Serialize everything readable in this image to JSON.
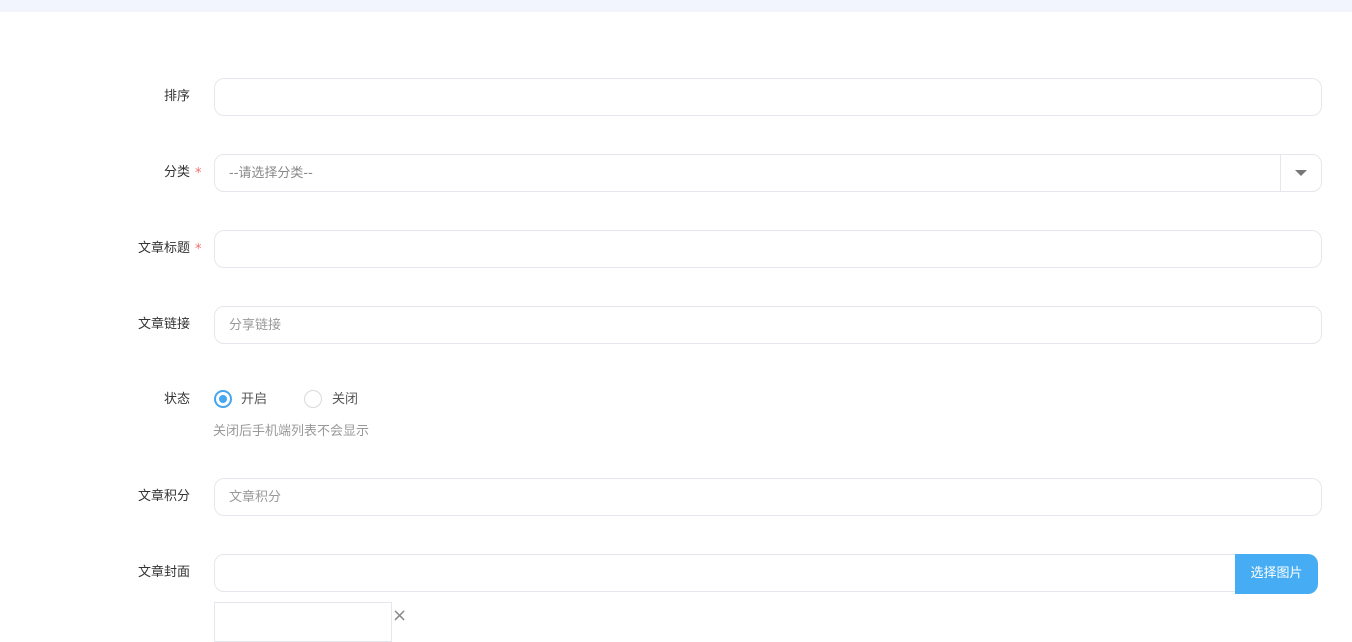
{
  "form": {
    "sort": {
      "label": "排序",
      "value": ""
    },
    "category": {
      "label": "分类",
      "required_mark": "*",
      "placeholder": "--请选择分类--"
    },
    "title": {
      "label": "文章标题",
      "required_mark": "*",
      "value": ""
    },
    "link": {
      "label": "文章链接",
      "placeholder": "分享链接"
    },
    "status": {
      "label": "状态",
      "options": [
        {
          "label": "开启",
          "checked": true
        },
        {
          "label": "关闭",
          "checked": false
        }
      ],
      "hint": "关闭后手机端列表不会显示"
    },
    "points": {
      "label": "文章积分",
      "placeholder": "文章积分"
    },
    "cover": {
      "label": "文章封面",
      "value": "",
      "button_label": "选择图片",
      "remove_icon": "×"
    }
  },
  "colors": {
    "accent": "#46adf4",
    "required": "#f56c6c",
    "border": "#e4e7ed",
    "top_strip": "#f2f5fd"
  }
}
